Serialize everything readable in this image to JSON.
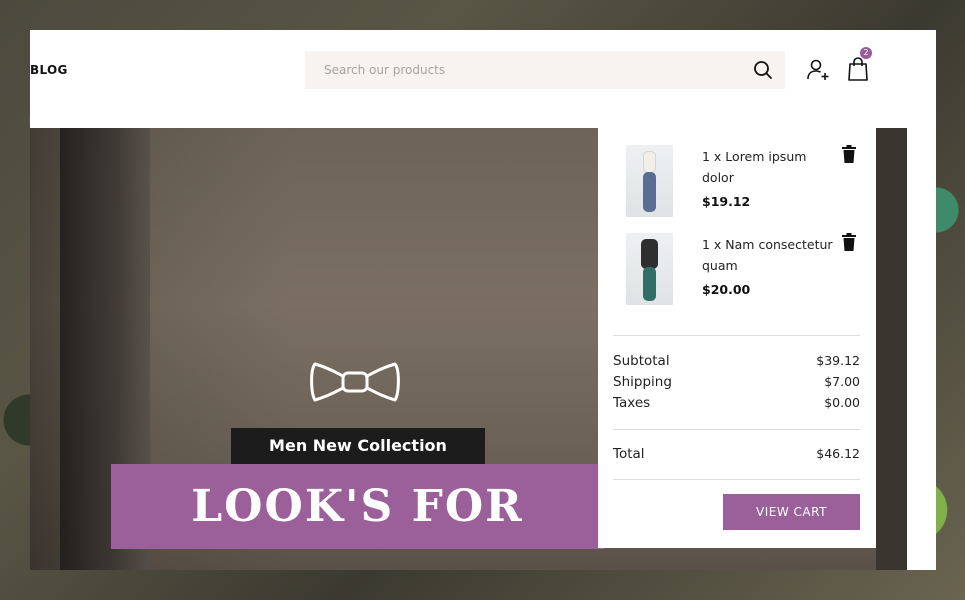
{
  "header": {
    "nav_blog": "BLOG",
    "search_placeholder": "Search our products",
    "cart_count": "2"
  },
  "hero": {
    "collection_label": "Men New Collection",
    "headline": "LOOK'S FOR STYLE"
  },
  "cart": {
    "items": [
      {
        "name": "1 x Lorem ipsum dolor",
        "price": "$19.12"
      },
      {
        "name": "1 x Nam consectetur quam",
        "price": "$20.00"
      }
    ],
    "subtotal_label": "Subtotal",
    "subtotal_value": "$39.12",
    "shipping_label": "Shipping",
    "shipping_value": "$7.00",
    "taxes_label": "Taxes",
    "taxes_value": "$0.00",
    "total_label": "Total",
    "total_value": "$46.12",
    "view_cart_label": "VIEW CART"
  },
  "colors": {
    "accent": "#9b5f9a",
    "dark": "#1c1c1c"
  }
}
